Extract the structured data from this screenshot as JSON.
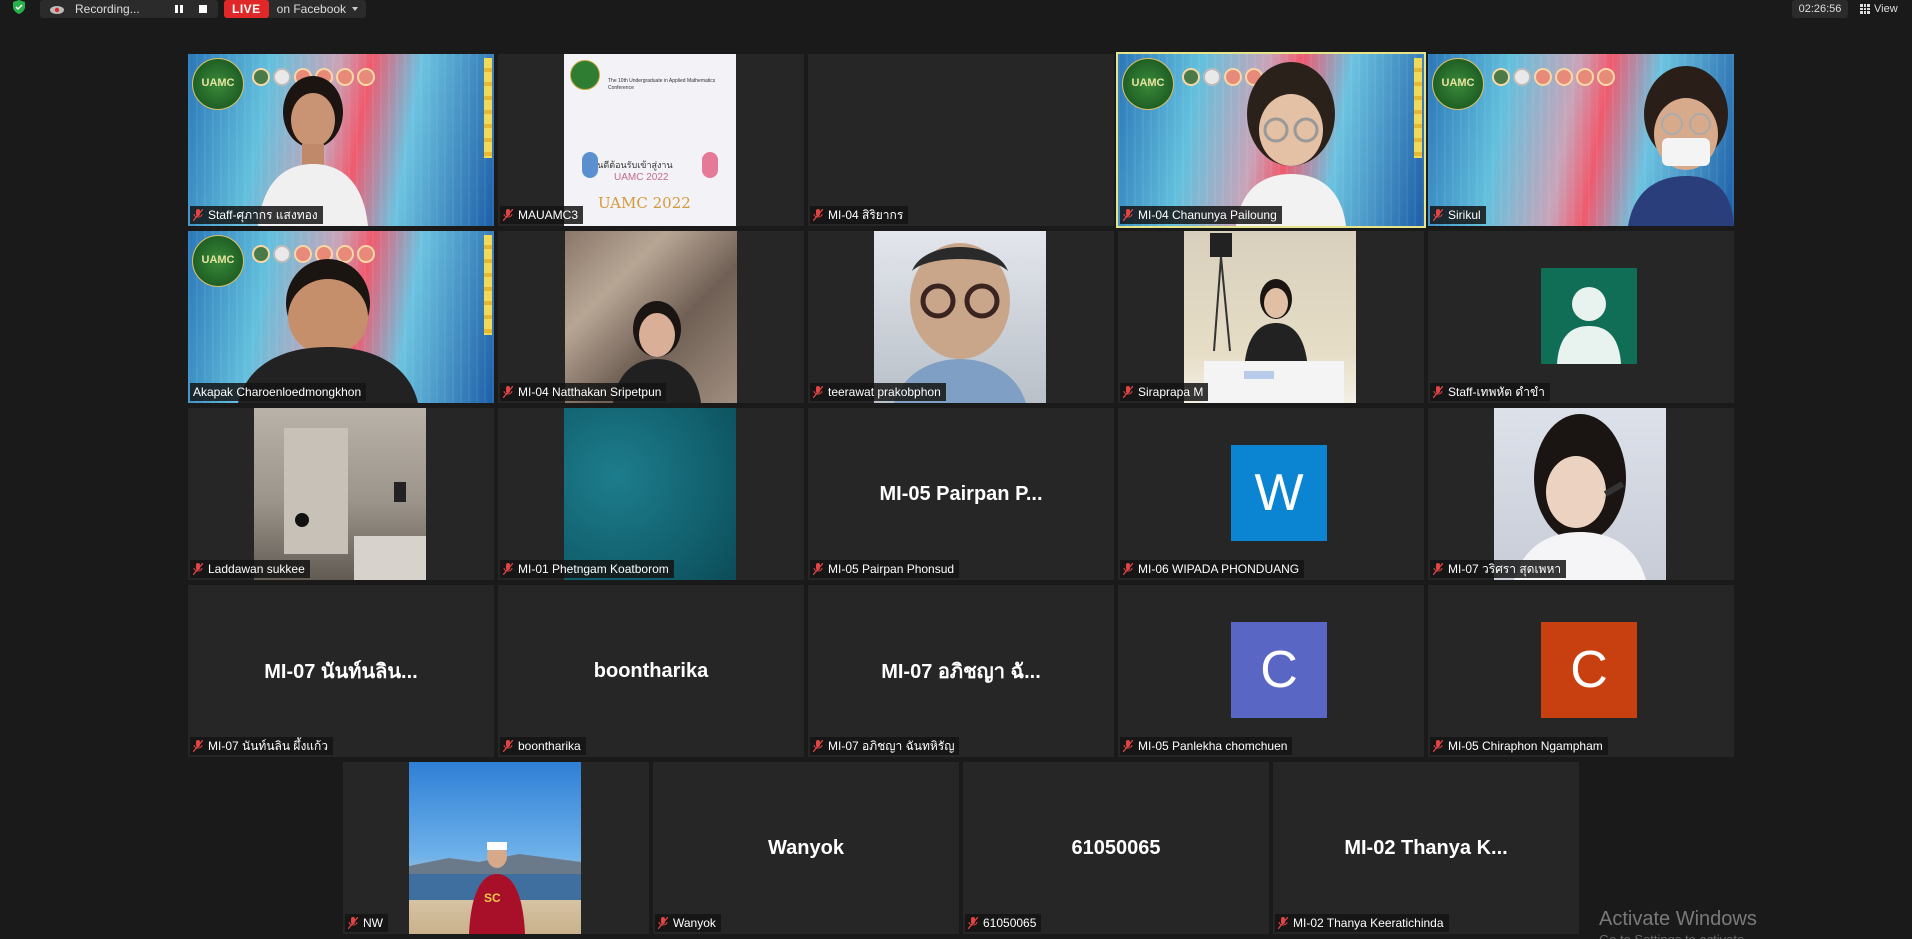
{
  "topbar": {
    "recording_label": "Recording...",
    "live_badge": "LIVE",
    "live_target": "on Facebook",
    "timer": "02:26:56",
    "view_label": "View"
  },
  "tiles": [
    {
      "name": "Staff-ศุภากร แสงทอง"
    },
    {
      "name": "MAUAMC3"
    },
    {
      "name": "MI-04 สิริยากร"
    },
    {
      "name": "MI-04 Chanunya Pailoung"
    },
    {
      "name": "Sirikul"
    },
    {
      "name": "Akapak Charoenloedmongkhon"
    },
    {
      "name": "MI-04 Natthakan Sripetpun"
    },
    {
      "name": "teerawat prakobphon"
    },
    {
      "name": "Siraprapa M"
    },
    {
      "name": "Staff-เทพหัต ดำขำ"
    },
    {
      "name": "Laddawan sukkee"
    },
    {
      "name": "MI-01 Phetngam Koatborom"
    },
    {
      "name": "MI-05 Pairpan Phonsud",
      "display_name": "MI-05 Pairpan P..."
    },
    {
      "name": "MI-06 WIPADA PHONDUANG",
      "avatar_letter": "W"
    },
    {
      "name": "MI-07 วริศรา สุดเพหา"
    },
    {
      "name": "MI-07 นันท์นลิน ผึ้งแก้ว",
      "display_name": "MI-07 นันท์นลิน..."
    },
    {
      "name": "boontharika",
      "display_name": "boontharika"
    },
    {
      "name": "MI-07 อภิชญา ฉันทหิรัญ",
      "display_name": "MI-07 อภิชญา ฉั..."
    },
    {
      "name": "MI-05 Panlekha chomchuen",
      "avatar_letter": "C"
    },
    {
      "name": "MI-05 Chiraphon Ngampham",
      "avatar_letter": "C"
    },
    {
      "name": "NW"
    },
    {
      "name": "Wanyok",
      "display_name": "Wanyok"
    },
    {
      "name": "61050065",
      "display_name": "61050065"
    },
    {
      "name": "MI-02 Thanya Keeratichinda",
      "display_name": "MI-02 Thanya K..."
    }
  ],
  "virtual_background": {
    "logo_text": "UAMC"
  },
  "poster": {
    "title_line1": "The 10th Undergraduate in Applied Mathematics Conference",
    "welcome": "ยินดีต้อนรับเข้าสู่งาน",
    "event": "UAMC 2022",
    "brand": "UAMC 2022"
  },
  "colors": {
    "accent_active": "#e6e48a",
    "avatar_w": "#0b84d1",
    "avatar_c_purple": "#5a66c4",
    "avatar_c_orange": "#c8400f",
    "live_red": "#e02828"
  },
  "watermark": {
    "line1": "Activate Windows",
    "line2": "Go to Settings to activate Windows."
  }
}
